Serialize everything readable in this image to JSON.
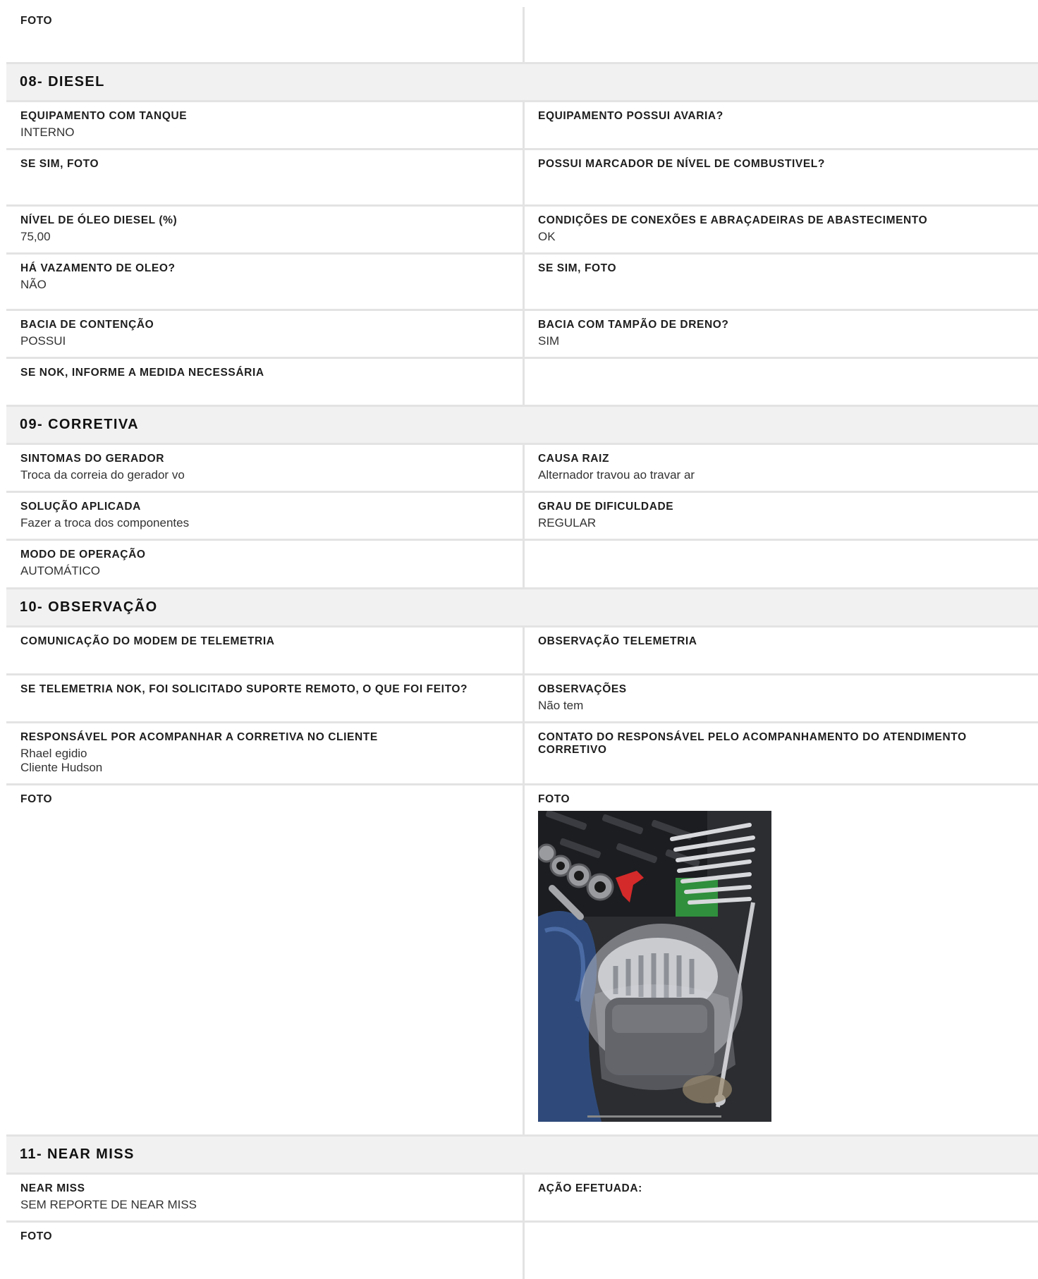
{
  "top": {
    "label": "FOTO"
  },
  "sections": {
    "diesel": {
      "title": "08- DIESEL",
      "fields": {
        "tanque_label": "EQUIPAMENTO COM TANQUE",
        "tanque_value": "INTERNO",
        "avaria_label": "EQUIPAMENTO POSSUI AVARIA?",
        "sesim_foto_label": "SE SIM, FOTO",
        "marcador_label": "POSSUI MARCADOR DE NÍVEL DE COMBUSTIVEL?",
        "nivel_label": "NÍVEL DE ÓLEO DIESEL (%)",
        "nivel_value": "75,00",
        "conexoes_label": "CONDIÇÕES DE CONEXÕES E ABRAÇADEIRAS DE ABASTECIMENTO",
        "conexoes_value": "OK",
        "vazamento_label": "HÁ VAZAMENTO DE OLEO?",
        "vazamento_value": "NÃO",
        "sesim_foto2_label": "SE SIM, FOTO",
        "bacia_label": "BACIA DE CONTENÇÃO",
        "bacia_value": "POSSUI",
        "tampao_label": "BACIA COM TAMPÃO DE DRENO?",
        "tampao_value": "SIM",
        "medida_label": "SE NOK, INFORME A MEDIDA NECESSÁRIA"
      }
    },
    "corretiva": {
      "title": "09- CORRETIVA",
      "fields": {
        "sintomas_label": "SINTOMAS DO GERADOR",
        "sintomas_value": "Troca da correia do gerador vo",
        "causa_label": "CAUSA RAIZ",
        "causa_value": "Alternador travou ao travar ar",
        "solucao_label": "SOLUÇÃO APLICADA",
        "solucao_value": "Fazer a troca dos componentes",
        "grau_label": "GRAU DE DIFICULDADE",
        "grau_value": "REGULAR",
        "modo_label": "MODO DE OPERAÇÃO",
        "modo_value": "AUTOMÁTICO"
      }
    },
    "observacao": {
      "title": "10- OBSERVAÇÃO",
      "fields": {
        "modem_label": "COMUNICAÇÃO DO MODEM DE TELEMETRIA",
        "obs_tel_label": "OBSERVAÇÃO TELEMETRIA",
        "suporte_label": "SE TELEMETRIA NOK, FOI SOLICITADO SUPORTE REMOTO, O QUE FOI FEITO?",
        "observacoes_label": "OBSERVAÇÕES",
        "observacoes_value": "Não tem",
        "responsavel_label": "RESPONSÁVEL POR ACOMPANHAR A CORRETIVA NO CLIENTE",
        "responsavel_value": "Rhael egidio\nCliente Hudson",
        "contato_label": "CONTATO DO RESPONSÁVEL PELO ACOMPANHAMENTO DO ATENDIMENTO CORRETIVO",
        "foto_left_label": "FOTO",
        "foto_right_label": "FOTO"
      }
    },
    "nearmiss": {
      "title": "11- NEAR MISS",
      "fields": {
        "nearmiss_label": "NEAR MISS",
        "nearmiss_value": "SEM REPORTE DE NEAR MISS",
        "acao_label": "AÇÃO EFETUADA:",
        "foto_label": "FOTO"
      }
    }
  }
}
